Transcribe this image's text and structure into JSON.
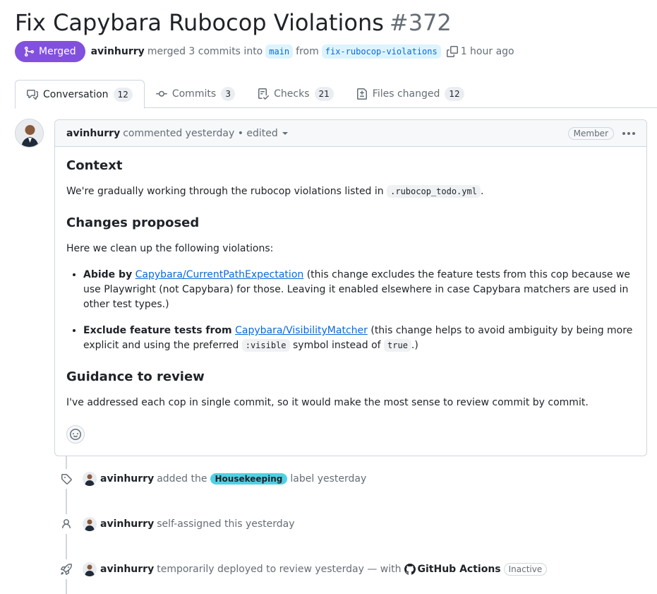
{
  "pr": {
    "title": "Fix Capybara Rubocop Violations",
    "number": "#372",
    "status": "Merged",
    "author": "avinhurry",
    "merged_text": "merged 3 commits into",
    "base_branch": "main",
    "from_text": "from",
    "head_branch": "fix-rubocop-violations",
    "time": "1 hour ago"
  },
  "tabs": [
    {
      "label": "Conversation",
      "count": "12",
      "icon": "comment-discussion-icon"
    },
    {
      "label": "Commits",
      "count": "3",
      "icon": "git-commit-icon"
    },
    {
      "label": "Checks",
      "count": "21",
      "icon": "checklist-icon"
    },
    {
      "label": "Files changed",
      "count": "12",
      "icon": "file-diff-icon"
    }
  ],
  "comment": {
    "author": "avinhurry",
    "meta": "commented yesterday • edited",
    "role": "Member",
    "context_heading": "Context",
    "context_text": "We're gradually working through the rubocop violations listed in",
    "context_code": ".rubocop_todo.yml",
    "context_end": ".",
    "changes_heading": "Changes proposed",
    "changes_intro": "Here we clean up the following violations:",
    "bullets": [
      {
        "bold": "Abide by",
        "link": "Capybara/CurrentPathExpectation",
        "text": "(this change excludes the feature tests from this cop because we use Playwright (not Capybara) for those. Leaving it enabled elsewhere in case Capybara matchers are used in other test types.)"
      },
      {
        "bold": "Exclude feature tests from",
        "link": "Capybara/VisibilityMatcher",
        "text1": "(this change helps to avoid ambiguity by being more explicit and using the preferred",
        "code1": ":visible",
        "text2": "symbol instead of",
        "code2": "true",
        "text3": ".)"
      }
    ],
    "guidance_heading": "Guidance to review",
    "guidance_text": "I've addressed each cop in single commit, so it would make the most sense to review commit by commit."
  },
  "timeline": [
    {
      "icon": "tag-icon",
      "author": "avinhurry",
      "text1": "added the",
      "label": "Housekeeping",
      "text2": "label yesterday"
    },
    {
      "icon": "person-icon",
      "author": "avinhurry",
      "text1": "self-assigned this yesterday"
    },
    {
      "icon": "rocket-icon",
      "author": "avinhurry",
      "text1": "temporarily deployed to review yesterday — with",
      "actor": "GitHub Actions",
      "badge": "Inactive"
    }
  ],
  "colors": {
    "merged": "#8250df",
    "label_housekeeping": "#51d0e4",
    "link": "#0969da"
  }
}
